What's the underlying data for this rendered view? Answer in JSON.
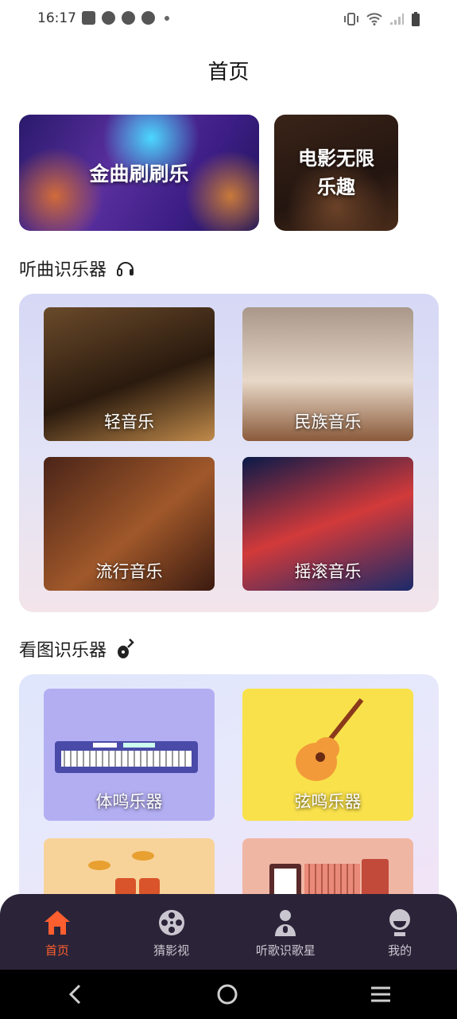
{
  "status_bar": {
    "time": "16:17"
  },
  "header": {
    "title": "首页"
  },
  "banners": [
    {
      "label": "金曲刷刷乐"
    },
    {
      "label_line1": "电影无限",
      "label_line2": "乐趣"
    }
  ],
  "section_listen": {
    "title": "听曲识乐器",
    "icon": "headphones-icon",
    "cards": [
      {
        "label": "轻音乐"
      },
      {
        "label": "民族音乐"
      },
      {
        "label": "流行音乐"
      },
      {
        "label": "摇滚音乐"
      }
    ]
  },
  "section_image": {
    "title": "看图识乐器",
    "icon": "guitar-icon",
    "cards": [
      {
        "label": "体鸣乐器"
      },
      {
        "label": "弦鸣乐器"
      },
      {
        "label": ""
      },
      {
        "label": ""
      }
    ]
  },
  "tabbar": {
    "items": [
      {
        "label": "首页",
        "icon": "home-icon",
        "active": true
      },
      {
        "label": "猜影视",
        "icon": "film-reel-icon",
        "active": false
      },
      {
        "label": "听歌识歌星",
        "icon": "singer-mic-icon",
        "active": false
      },
      {
        "label": "我的",
        "icon": "profile-icon",
        "active": false
      }
    ]
  },
  "colors": {
    "accent": "#ff5e2f",
    "tabbar_bg": "#2b2438"
  }
}
